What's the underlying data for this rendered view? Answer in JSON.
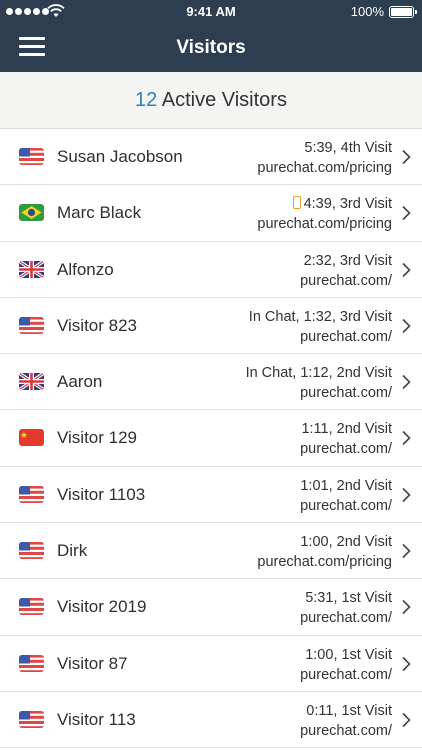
{
  "status_bar": {
    "time": "9:41 AM",
    "battery": "100%"
  },
  "header": {
    "title": "Visitors"
  },
  "summary": {
    "count": "12",
    "label": "Active Visitors"
  },
  "visitors": [
    {
      "name": "Susan Jacobson",
      "flag": "us",
      "info": "5:39, 4th Visit",
      "url": "purechat.com/pricing",
      "mobile": false
    },
    {
      "name": "Marc Black",
      "flag": "br",
      "info": "4:39, 3rd Visit",
      "url": "purechat.com/pricing",
      "mobile": true
    },
    {
      "name": "Alfonzo",
      "flag": "uk",
      "info": "2:32, 3rd Visit",
      "url": "purechat.com/",
      "mobile": false
    },
    {
      "name": "Visitor 823",
      "flag": "us",
      "info": "In Chat, 1:32, 3rd Visit",
      "url": "purechat.com/",
      "mobile": false
    },
    {
      "name": "Aaron",
      "flag": "uk",
      "info": "In Chat, 1:12, 2nd Visit",
      "url": "purechat.com/",
      "mobile": false
    },
    {
      "name": "Visitor 129",
      "flag": "cn",
      "info": "1:11, 2nd Visit",
      "url": "purechat.com/",
      "mobile": false
    },
    {
      "name": "Visitor 1103",
      "flag": "us",
      "info": "1:01, 2nd Visit",
      "url": "purechat.com/",
      "mobile": false
    },
    {
      "name": "Dirk",
      "flag": "us",
      "info": "1:00, 2nd Visit",
      "url": "purechat.com/pricing",
      "mobile": false
    },
    {
      "name": "Visitor 2019",
      "flag": "us",
      "info": "5:31, 1st Visit",
      "url": "purechat.com/",
      "mobile": false
    },
    {
      "name": "Visitor 87",
      "flag": "us",
      "info": "1:00, 1st Visit",
      "url": "purechat.com/",
      "mobile": false
    },
    {
      "name": "Visitor 113",
      "flag": "us",
      "info": "0:11, 1st Visit",
      "url": "purechat.com/",
      "mobile": false
    }
  ],
  "colors": {
    "navbar": "#2c3e50",
    "accent_count": "#2f80c7",
    "mobile_indicator": "#f0a020"
  }
}
